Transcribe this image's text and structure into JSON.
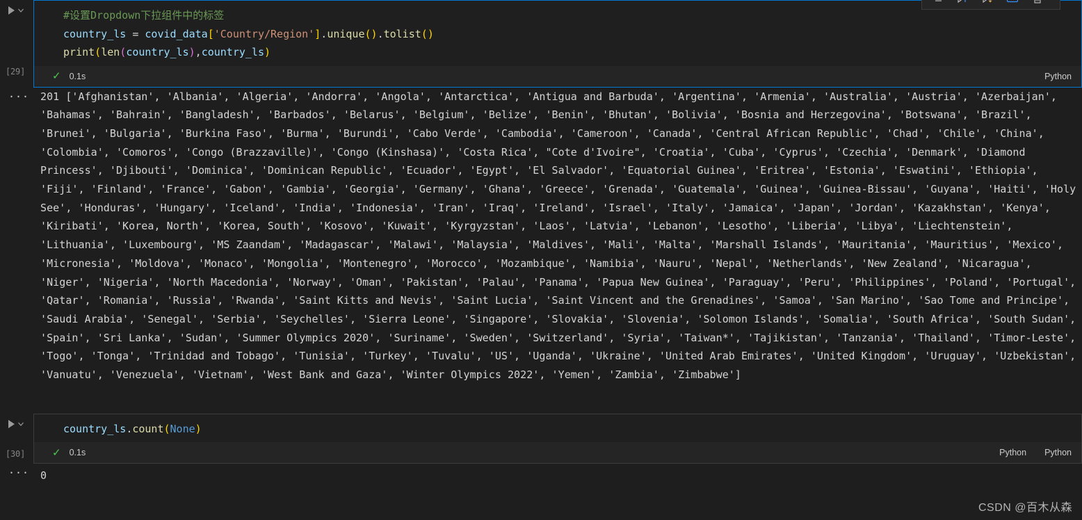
{
  "toolbar": {
    "buttons": [
      {
        "name": "more-actions-icon",
        "label": "More Actions"
      },
      {
        "name": "run-above-icon",
        "label": "Execute Above Cells"
      },
      {
        "name": "run-below-icon",
        "label": "Execute Cell and Below"
      },
      {
        "name": "clear-output-icon",
        "label": "Clear Outputs"
      },
      {
        "name": "delete-cell-icon",
        "label": "Delete Cell"
      }
    ]
  },
  "cells": [
    {
      "exec_count": "[29]",
      "run_tooltip": "Execute Cell",
      "code_lines": [
        {
          "segments": [
            {
              "text": "#设置Dropdown下拉组件中的标签",
              "cls": "c-comment"
            }
          ]
        },
        {
          "segments": [
            {
              "text": "country_ls",
              "cls": "c-var"
            },
            {
              "text": " ",
              "cls": "c-op"
            },
            {
              "text": "=",
              "cls": "c-op"
            },
            {
              "text": " ",
              "cls": "c-op"
            },
            {
              "text": "covid_data",
              "cls": "c-var"
            },
            {
              "text": "[",
              "cls": "c-br1"
            },
            {
              "text": "'Country/Region'",
              "cls": "c-str"
            },
            {
              "text": "]",
              "cls": "c-br1"
            },
            {
              "text": ".",
              "cls": "c-punct"
            },
            {
              "text": "unique",
              "cls": "c-fn"
            },
            {
              "text": "(",
              "cls": "c-br1"
            },
            {
              "text": ")",
              "cls": "c-br1"
            },
            {
              "text": ".",
              "cls": "c-punct"
            },
            {
              "text": "tolist",
              "cls": "c-fn"
            },
            {
              "text": "(",
              "cls": "c-br1"
            },
            {
              "text": ")",
              "cls": "c-br1"
            }
          ]
        },
        {
          "segments": [
            {
              "text": "print",
              "cls": "c-fn"
            },
            {
              "text": "(",
              "cls": "c-br1"
            },
            {
              "text": "len",
              "cls": "c-fn"
            },
            {
              "text": "(",
              "cls": "c-br2"
            },
            {
              "text": "country_ls",
              "cls": "c-var"
            },
            {
              "text": ")",
              "cls": "c-br2"
            },
            {
              "text": ",",
              "cls": "c-punct"
            },
            {
              "text": "country_ls",
              "cls": "c-var"
            },
            {
              "text": ")",
              "cls": "c-br1"
            }
          ]
        }
      ],
      "status": {
        "check": "✓",
        "elapsed": "0.1s",
        "lang_labels": [
          "Python"
        ]
      },
      "active": true,
      "output_dots": "···",
      "output": "201 ['Afghanistan', 'Albania', 'Algeria', 'Andorra', 'Angola', 'Antarctica', 'Antigua and Barbuda', 'Argentina', 'Armenia', 'Australia', 'Austria', 'Azerbaijan', 'Bahamas', 'Bahrain', 'Bangladesh', 'Barbados', 'Belarus', 'Belgium', 'Belize', 'Benin', 'Bhutan', 'Bolivia', 'Bosnia and Herzegovina', 'Botswana', 'Brazil', 'Brunei', 'Bulgaria', 'Burkina Faso', 'Burma', 'Burundi', 'Cabo Verde', 'Cambodia', 'Cameroon', 'Canada', 'Central African Republic', 'Chad', 'Chile', 'China', 'Colombia', 'Comoros', 'Congo (Brazzaville)', 'Congo (Kinshasa)', 'Costa Rica', \"Cote d'Ivoire\", 'Croatia', 'Cuba', 'Cyprus', 'Czechia', 'Denmark', 'Diamond Princess', 'Djibouti', 'Dominica', 'Dominican Republic', 'Ecuador', 'Egypt', 'El Salvador', 'Equatorial Guinea', 'Eritrea', 'Estonia', 'Eswatini', 'Ethiopia', 'Fiji', 'Finland', 'France', 'Gabon', 'Gambia', 'Georgia', 'Germany', 'Ghana', 'Greece', 'Grenada', 'Guatemala', 'Guinea', 'Guinea-Bissau', 'Guyana', 'Haiti', 'Holy See', 'Honduras', 'Hungary', 'Iceland', 'India', 'Indonesia', 'Iran', 'Iraq', 'Ireland', 'Israel', 'Italy', 'Jamaica', 'Japan', 'Jordan', 'Kazakhstan', 'Kenya', 'Kiribati', 'Korea, North', 'Korea, South', 'Kosovo', 'Kuwait', 'Kyrgyzstan', 'Laos', 'Latvia', 'Lebanon', 'Lesotho', 'Liberia', 'Libya', 'Liechtenstein', 'Lithuania', 'Luxembourg', 'MS Zaandam', 'Madagascar', 'Malawi', 'Malaysia', 'Maldives', 'Mali', 'Malta', 'Marshall Islands', 'Mauritania', 'Mauritius', 'Mexico', 'Micronesia', 'Moldova', 'Monaco', 'Mongolia', 'Montenegro', 'Morocco', 'Mozambique', 'Namibia', 'Nauru', 'Nepal', 'Netherlands', 'New Zealand', 'Nicaragua', 'Niger', 'Nigeria', 'North Macedonia', 'Norway', 'Oman', 'Pakistan', 'Palau', 'Panama', 'Papua New Guinea', 'Paraguay', 'Peru', 'Philippines', 'Poland', 'Portugal', 'Qatar', 'Romania', 'Russia', 'Rwanda', 'Saint Kitts and Nevis', 'Saint Lucia', 'Saint Vincent and the Grenadines', 'Samoa', 'San Marino', 'Sao Tome and Principe', 'Saudi Arabia', 'Senegal', 'Serbia', 'Seychelles', 'Sierra Leone', 'Singapore', 'Slovakia', 'Slovenia', 'Solomon Islands', 'Somalia', 'South Africa', 'South Sudan', 'Spain', 'Sri Lanka', 'Sudan', 'Summer Olympics 2020', 'Suriname', 'Sweden', 'Switzerland', 'Syria', 'Taiwan*', 'Tajikistan', 'Tanzania', 'Thailand', 'Timor-Leste', 'Togo', 'Tonga', 'Trinidad and Tobago', 'Tunisia', 'Turkey', 'Tuvalu', 'US', 'Uganda', 'Ukraine', 'United Arab Emirates', 'United Kingdom', 'Uruguay', 'Uzbekistan', 'Vanuatu', 'Venezuela', 'Vietnam', 'West Bank and Gaza', 'Winter Olympics 2022', 'Yemen', 'Zambia', 'Zimbabwe']"
    },
    {
      "exec_count": "[30]",
      "run_tooltip": "Execute Cell",
      "code_lines": [
        {
          "segments": [
            {
              "text": "country_ls",
              "cls": "c-var"
            },
            {
              "text": ".",
              "cls": "c-punct"
            },
            {
              "text": "count",
              "cls": "c-fn"
            },
            {
              "text": "(",
              "cls": "c-br1"
            },
            {
              "text": "None",
              "cls": "c-kw"
            },
            {
              "text": ")",
              "cls": "c-br1"
            }
          ]
        }
      ],
      "status": {
        "check": "✓",
        "elapsed": "0.1s",
        "lang_labels": [
          "Python",
          "Python"
        ]
      },
      "active": false,
      "output_dots": "···",
      "output": "0"
    }
  ],
  "watermark": "CSDN @百木从森",
  "colors": {
    "background": "#1e1e1e",
    "cell_background": "#1f1f1f",
    "active_border": "#0078d4",
    "inactive_border": "#3c3c3c",
    "comment": "#6a9955",
    "variable": "#9cdcfe",
    "string": "#ce9178",
    "function": "#dcdcaa",
    "keyword": "#569cd6",
    "success": "#4ec94e",
    "output_text": "#d4d4d4"
  }
}
